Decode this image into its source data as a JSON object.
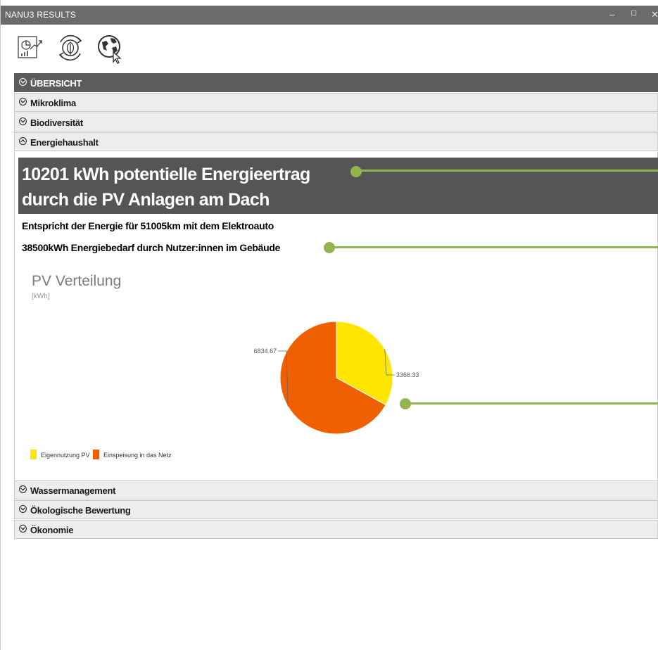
{
  "window": {
    "title": "NANU3 RESULTS",
    "minimize_icon": "minimize-icon",
    "maximize_icon": "maximize-icon",
    "close_icon": "close-icon"
  },
  "toolbar": {
    "icons": [
      "chart-report-icon",
      "leaf-cycle-icon",
      "globe-cursor-icon"
    ]
  },
  "sections": [
    {
      "label": "ÜBERSICHT",
      "expanded": false,
      "highlighted": true
    },
    {
      "label": "Mikroklima",
      "expanded": false
    },
    {
      "label": "Biodiversität",
      "expanded": false
    },
    {
      "label": "Energiehaushalt",
      "expanded": true
    },
    {
      "label": "Wassermanagement",
      "expanded": false
    },
    {
      "label": "Ökologische Bewertung",
      "expanded": false
    },
    {
      "label": "Ökonomie",
      "expanded": false
    }
  ],
  "energy": {
    "headline_line1": "10201 kWh potentielle Energieertrag",
    "headline_line2": "durch die PV Anlagen am Dach",
    "equivalent": "Entspricht der Energie für 51005km mit dem Elektroauto",
    "demand": "38500kWh Energiebedarf durch Nutzer:innen im Gebäude"
  },
  "colors": {
    "accent_green": "#93b54f",
    "header_dark": "#555555",
    "pie_yellow": "#ffe500",
    "pie_orange": "#f06000"
  },
  "chart_data": {
    "type": "pie",
    "title": "PV Verteilung",
    "subtitle": "[kWh]",
    "slices": [
      {
        "name": "Eigennutzung PV",
        "value": 3366.33,
        "color": "#ffe500"
      },
      {
        "name": "Einspeisung in das Netz",
        "value": 6834.67,
        "color": "#f06000"
      }
    ],
    "data_labels": [
      "3366.33",
      "6834.67"
    ],
    "legend_position": "bottom-left"
  }
}
